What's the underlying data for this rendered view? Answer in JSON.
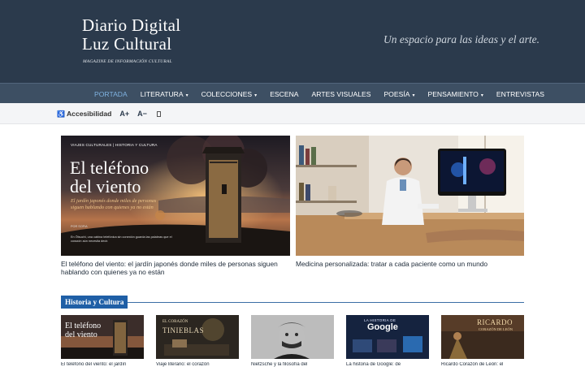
{
  "header": {
    "logo_line1": "Diario Digital",
    "logo_line2": "Luz Cultural",
    "logo_subtitle": "MAGAZINE DE INFORMACIÓN CULTURAL",
    "tagline": "Un espacio para las ideas y el arte."
  },
  "nav": {
    "items": [
      {
        "label": "PORTADA",
        "active": true,
        "dropdown": false
      },
      {
        "label": "LITERATURA",
        "dropdown": true
      },
      {
        "label": "COLECCIONES",
        "dropdown": true
      },
      {
        "label": "ESCENA",
        "dropdown": false
      },
      {
        "label": "ARTES VISUALES",
        "dropdown": false
      },
      {
        "label": "POESÍA",
        "dropdown": true
      },
      {
        "label": "PENSAMIENTO",
        "dropdown": true
      },
      {
        "label": "ENTREVISTAS",
        "dropdown": false
      }
    ],
    "caret": "▾"
  },
  "accessibility": {
    "icon": "wheelchair-icon",
    "label": "Accesibilidad",
    "increase": "A+",
    "decrease": "A−"
  },
  "featured": [
    {
      "image": {
        "kicker": "VIAJES CULTURALES | HISTORIA Y CULTURA",
        "title_line1": "El teléfono",
        "title_line2": "del viento",
        "subtitle": "El jardín japonés donde miles de personas siguen hablando con quienes ya no están",
        "byline": "POR SOFIA",
        "blurb": "En Ōtsuchi, una cabina telefónica sin conexión guarda las palabras que el corazón aún necesita decir."
      },
      "caption": "El teléfono del viento: el jardín japonés donde miles de personas siguen hablando con quienes ya no están"
    },
    {
      "caption": "Medicina personalizada: tratar a cada paciente como un mundo"
    }
  ],
  "section": {
    "label": "Historia y Cultura"
  },
  "thumbs": [
    {
      "title_line1": "El teléfono",
      "title_line2": "del viento",
      "caption": "El teléfono del viento: el jardín"
    },
    {
      "title_line1": "EL CORAZÓN",
      "title_line2": "TINIEBLAS",
      "caption": "Viaje literario: el corazón"
    },
    {
      "caption": "Nietzsche y la filosofía del"
    },
    {
      "title_line1": "LA HISTORIA DE",
      "title_line2": "Google",
      "caption": "La historia de Google: de"
    },
    {
      "title_line1": "RICARDO",
      "title_line2": "CORAZÓN DE LEÓN",
      "caption": "Ricardo Corazón de León: el"
    }
  ],
  "colors": {
    "header_bg": "#2b3a4c",
    "nav_bg": "#3d4f63",
    "nav_active": "#7fb2e0",
    "section_blue": "#1f5fa6"
  }
}
